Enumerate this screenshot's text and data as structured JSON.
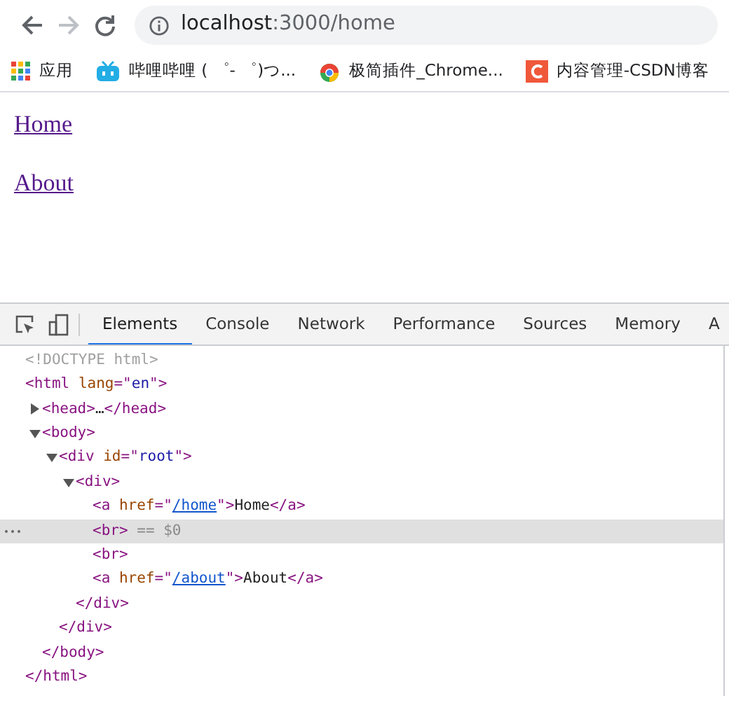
{
  "toolbar": {
    "back_disabled": false,
    "forward_disabled": true,
    "address": {
      "host": "localhost",
      "path": ":3000/home"
    }
  },
  "bookmarks": [
    {
      "label": "应用",
      "kind": "apps"
    },
    {
      "label": "哔哩哔哩 ( ゜- ゜)つ...",
      "kind": "tv"
    },
    {
      "label": "极简插件_Chrome...",
      "kind": "chrome"
    },
    {
      "label": "内容管理-CSDN博客",
      "kind": "c-logo"
    }
  ],
  "page_links": [
    "Home",
    "About"
  ],
  "devtools": {
    "tabs": [
      {
        "label": "Elements",
        "selected": true
      },
      {
        "label": "Console",
        "selected": false
      },
      {
        "label": "Network",
        "selected": false
      },
      {
        "label": "Performance",
        "selected": false
      },
      {
        "label": "Sources",
        "selected": false
      },
      {
        "label": "Memory",
        "selected": false
      },
      {
        "label": "A",
        "selected": false
      }
    ],
    "dom_tree": [
      {
        "selected": false,
        "tokens": [
          {
            "kind": "doctype",
            "text": "<!DOCTYPE html>"
          }
        ]
      },
      {
        "selected": false,
        "tokens": [
          {
            "kind": "tag",
            "text": "<html "
          },
          {
            "kind": "attr",
            "text": "lang"
          },
          {
            "kind": "tag",
            "text": "=\""
          },
          {
            "kind": "value",
            "text": "en"
          },
          {
            "kind": "tag",
            "text": "\">"
          }
        ],
        "children": [
          {
            "selected": false,
            "expanded": false,
            "tokens": [
              {
                "kind": "tag",
                "text": "<head>"
              },
              {
                "kind": "text",
                "text": "…"
              },
              {
                "kind": "tag",
                "text": "</head>"
              }
            ]
          },
          {
            "selected": false,
            "expanded": true,
            "tokens": [
              {
                "kind": "tag",
                "text": "<body>"
              }
            ],
            "children": [
              {
                "selected": false,
                "expanded": true,
                "tokens": [
                  {
                    "kind": "tag",
                    "text": "<div "
                  },
                  {
                    "kind": "attr",
                    "text": "id"
                  },
                  {
                    "kind": "tag",
                    "text": "=\""
                  },
                  {
                    "kind": "value",
                    "text": "root"
                  },
                  {
                    "kind": "tag",
                    "text": "\">"
                  }
                ],
                "children": [
                  {
                    "selected": false,
                    "expanded": true,
                    "tokens": [
                      {
                        "kind": "tag",
                        "text": "<div>"
                      }
                    ],
                    "children": [
                      {
                        "selected": false,
                        "tokens": [
                          {
                            "kind": "tag",
                            "text": "<a "
                          },
                          {
                            "kind": "attr",
                            "text": "href"
                          },
                          {
                            "kind": "tag",
                            "text": "=\""
                          },
                          {
                            "kind": "link",
                            "text": "/home"
                          },
                          {
                            "kind": "tag",
                            "text": "\">"
                          },
                          {
                            "kind": "text",
                            "text": "Home"
                          },
                          {
                            "kind": "tag",
                            "text": "</a>"
                          }
                        ]
                      },
                      {
                        "selected": true,
                        "tokens": [
                          {
                            "kind": "tag",
                            "text": "<br>"
                          },
                          {
                            "kind": "hint",
                            "text": " == $0"
                          }
                        ]
                      },
                      {
                        "selected": false,
                        "tokens": [
                          {
                            "kind": "tag",
                            "text": "<br>"
                          }
                        ]
                      },
                      {
                        "selected": false,
                        "tokens": [
                          {
                            "kind": "tag",
                            "text": "<a "
                          },
                          {
                            "kind": "attr",
                            "text": "href"
                          },
                          {
                            "kind": "tag",
                            "text": "=\""
                          },
                          {
                            "kind": "link",
                            "text": "/about"
                          },
                          {
                            "kind": "tag",
                            "text": "\">"
                          },
                          {
                            "kind": "text",
                            "text": "About"
                          },
                          {
                            "kind": "tag",
                            "text": "</a>"
                          }
                        ]
                      }
                    ],
                    "close": [
                      {
                        "kind": "tag",
                        "text": "</div>"
                      }
                    ]
                  }
                ],
                "close": [
                  {
                    "kind": "tag",
                    "text": "</div>"
                  }
                ]
              }
            ],
            "close": [
              {
                "kind": "tag",
                "text": "</body>"
              }
            ]
          }
        ],
        "close": [
          {
            "kind": "tag",
            "text": "</html>"
          }
        ]
      }
    ]
  }
}
